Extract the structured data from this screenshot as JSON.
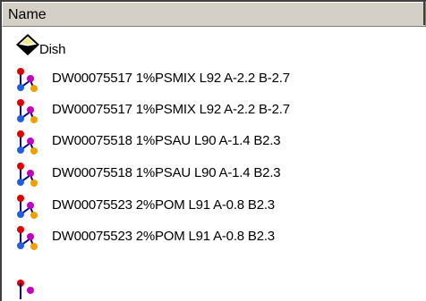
{
  "list": {
    "column_header": "Name",
    "items": [
      {
        "label": "Dish",
        "icon": "dish-icon"
      },
      {
        "label": "DW00075517 1%PSMIX L92 A-2.2 B-2.7",
        "icon": "molecule-icon"
      },
      {
        "label": "DW00075517 1%PSMIX L92 A-2.2 B-2.7",
        "icon": "molecule-icon"
      },
      {
        "label": "DW00075518 1%PSAU L90 A-1.4 B2.3",
        "icon": "molecule-icon"
      },
      {
        "label": "DW00075518 1%PSAU L90 A-1.4 B2.3",
        "icon": "molecule-icon"
      },
      {
        "label": "DW00075523 2%POM L91 A-0.8 B2.3",
        "icon": "molecule-icon"
      },
      {
        "label": "DW00075523 2%POM L91 A-0.8 B2.3",
        "icon": "molecule-icon"
      }
    ]
  },
  "colors": {
    "header_bg": "#d4d0c8",
    "list_bg": "#ffffff"
  }
}
